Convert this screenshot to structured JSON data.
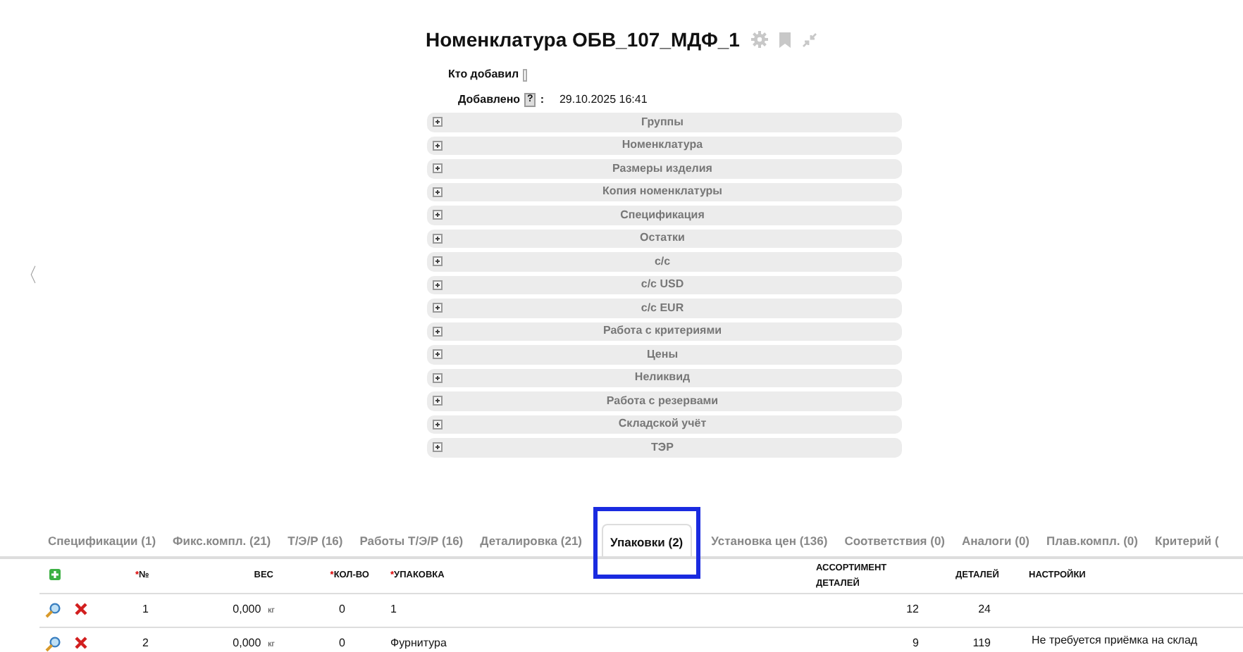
{
  "title": "Номенклатура ОБВ_107_МДФ_1",
  "info": [
    {
      "kind": "field",
      "label": "Кто добавил"
    },
    {
      "kind": "help",
      "label": "Добавлено",
      "help": "?",
      "separator": ":",
      "value": "29.10.2025 16:41"
    }
  ],
  "sections": [
    {
      "label": "Группы",
      "expanded": false
    },
    {
      "label": "Номенклатура",
      "expanded": false
    },
    {
      "label": "Размеры изделия",
      "expanded": false
    },
    {
      "label": "Копия номенклатуры",
      "expanded": false
    },
    {
      "label": "Спецификация",
      "expanded": false
    },
    {
      "label": "Остатки",
      "expanded": false
    },
    {
      "label": "с/с",
      "expanded": false
    },
    {
      "label": "с/с USD",
      "expanded": false
    },
    {
      "label": "с/с EUR",
      "expanded": false
    },
    {
      "label": "Работа с критериями",
      "expanded": false
    },
    {
      "label": "Цены",
      "expanded": false
    },
    {
      "label": "Неликвид",
      "expanded": false
    },
    {
      "label": "Работа с резервами",
      "expanded": false
    },
    {
      "label": "Складской учёт",
      "expanded": false
    },
    {
      "label": "ТЭР",
      "expanded": false
    }
  ],
  "nav_prev": "〈",
  "tabs": [
    {
      "label": "Спецификации (1)",
      "selected": false
    },
    {
      "label": "Фикс.компл. (21)",
      "selected": false
    },
    {
      "label": "Т/Э/Р (16)",
      "selected": false
    },
    {
      "label": "Работы Т/Э/Р (16)",
      "selected": false
    },
    {
      "label": "Деталировка (21)",
      "selected": false
    },
    {
      "label": "Упаковки (2)",
      "selected": true
    },
    {
      "label": "Установка цен (136)",
      "selected": false
    },
    {
      "label": "Соответствия (0)",
      "selected": false
    },
    {
      "label": "Аналоги (0)",
      "selected": false
    },
    {
      "label": "Плав.компл. (0)",
      "selected": false
    },
    {
      "label": "Критерий (",
      "selected": false
    }
  ],
  "table": {
    "required_mark": "*",
    "columns": [
      {
        "label": "№",
        "required": true
      },
      {
        "label": "ВЕС",
        "required": false
      },
      {
        "label": "КОЛ-ВО",
        "required": true
      },
      {
        "label": "УПАКОВКА",
        "required": true
      },
      {
        "label": "АССОРТИМЕНТ ДЕТАЛЕЙ",
        "required": false
      },
      {
        "label": "ДЕТАЛЕЙ",
        "required": false
      },
      {
        "label": "НАСТРОЙКИ",
        "required": false
      }
    ],
    "rows": [
      {
        "number": "1",
        "weight": "0,000",
        "unit": "кг",
        "quantity": "0",
        "package": "1",
        "assortment": "12",
        "parts": "24"
      },
      {
        "number": "2",
        "weight": "0,000",
        "unit": "кг",
        "quantity": "0",
        "package": "Фурнитура",
        "assortment": "9",
        "parts": "119",
        "settings": "Не требуется приёмка на склад"
      }
    ]
  }
}
